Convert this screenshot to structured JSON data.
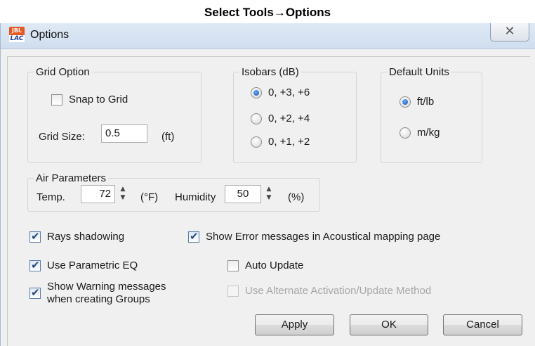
{
  "caption": "Select Tools→Options",
  "window": {
    "title": "Options",
    "icon": "jbl-lac-app-icon",
    "close_glyph": "✕"
  },
  "grid_option": {
    "title": "Grid Option",
    "snap_label": "Snap to Grid",
    "snap_checked": false,
    "size_label": "Grid Size:",
    "size_value": "0.5",
    "size_unit": "(ft)"
  },
  "isobars": {
    "title": "Isobars (dB)",
    "options": [
      "0, +3, +6",
      "0, +2, +4",
      "0, +1, +2"
    ],
    "selected": "0, +3, +6"
  },
  "default_units": {
    "title": "Default Units",
    "options": [
      "ft/lb",
      "m/kg"
    ],
    "selected": "ft/lb"
  },
  "air_parameters": {
    "title": "Air Parameters",
    "temp_label": "Temp.",
    "temp_value": "72",
    "temp_unit": "(°F)",
    "humidity_label": "Humidity",
    "humidity_value": "50",
    "humidity_unit": "(%)"
  },
  "checkboxes": {
    "rays_shadowing": {
      "label": "Rays shadowing",
      "checked": true
    },
    "show_error": {
      "label": "Show Error messages in Acoustical mapping page",
      "checked": true
    },
    "parametric_eq": {
      "label": "Use Parametric EQ",
      "checked": true
    },
    "auto_update": {
      "label": "Auto Update",
      "checked": false
    },
    "warning_line1": "Show Warning messages",
    "warning_line2": "when creating Groups",
    "warning_checked": true,
    "alternate_activation": {
      "label": "Use Alternate Activation/Update Method",
      "checked": false,
      "enabled": false
    }
  },
  "buttons": {
    "apply": "Apply",
    "ok": "OK",
    "cancel": "Cancel"
  },
  "colors": {
    "titlebar": "#cfdeef",
    "dialog_bg": "#f0f0f0",
    "radio_selected": "#1d4fa5",
    "disabled_text": "#a6a6a6"
  }
}
